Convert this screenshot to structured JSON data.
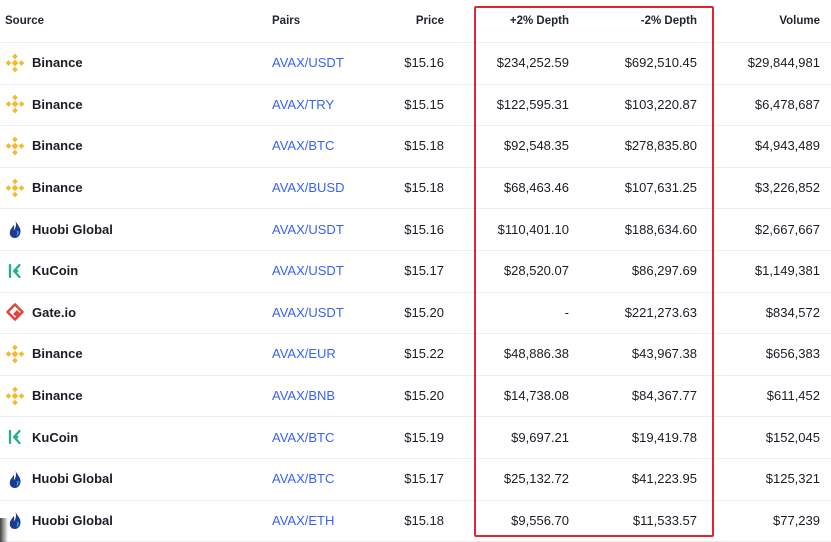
{
  "headers": {
    "source": "Source",
    "pairs": "Pairs",
    "price": "Price",
    "plus_depth": "+2% Depth",
    "minus_depth": "-2% Depth",
    "volume": "Volume"
  },
  "colors": {
    "pair_link": "#3861fb",
    "highlight_border": "#dc2633",
    "binance": "#f3ba2f",
    "huobi": "#1a3b8f",
    "kucoin": "#23af91",
    "gate": "#e0463c"
  },
  "rows": [
    {
      "exchange": "Binance",
      "icon": "binance-icon",
      "pair": "AVAX/USDT",
      "price": "$15.16",
      "plus_depth": "$234,252.59",
      "minus_depth": "$692,510.45",
      "volume": "$29,844,981"
    },
    {
      "exchange": "Binance",
      "icon": "binance-icon",
      "pair": "AVAX/TRY",
      "price": "$15.15",
      "plus_depth": "$122,595.31",
      "minus_depth": "$103,220.87",
      "volume": "$6,478,687"
    },
    {
      "exchange": "Binance",
      "icon": "binance-icon",
      "pair": "AVAX/BTC",
      "price": "$15.18",
      "plus_depth": "$92,548.35",
      "minus_depth": "$278,835.80",
      "volume": "$4,943,489"
    },
    {
      "exchange": "Binance",
      "icon": "binance-icon",
      "pair": "AVAX/BUSD",
      "price": "$15.18",
      "plus_depth": "$68,463.46",
      "minus_depth": "$107,631.25",
      "volume": "$3,226,852"
    },
    {
      "exchange": "Huobi Global",
      "icon": "huobi-icon",
      "pair": "AVAX/USDT",
      "price": "$15.16",
      "plus_depth": "$110,401.10",
      "minus_depth": "$188,634.60",
      "volume": "$2,667,667"
    },
    {
      "exchange": "KuCoin",
      "icon": "kucoin-icon",
      "pair": "AVAX/USDT",
      "price": "$15.17",
      "plus_depth": "$28,520.07",
      "minus_depth": "$86,297.69",
      "volume": "$1,149,381"
    },
    {
      "exchange": "Gate.io",
      "icon": "gate-icon",
      "pair": "AVAX/USDT",
      "price": "$15.20",
      "plus_depth": "-",
      "minus_depth": "$221,273.63",
      "volume": "$834,572"
    },
    {
      "exchange": "Binance",
      "icon": "binance-icon",
      "pair": "AVAX/EUR",
      "price": "$15.22",
      "plus_depth": "$48,886.38",
      "minus_depth": "$43,967.38",
      "volume": "$656,383"
    },
    {
      "exchange": "Binance",
      "icon": "binance-icon",
      "pair": "AVAX/BNB",
      "price": "$15.20",
      "plus_depth": "$14,738.08",
      "minus_depth": "$84,367.77",
      "volume": "$611,452"
    },
    {
      "exchange": "KuCoin",
      "icon": "kucoin-icon",
      "pair": "AVAX/BTC",
      "price": "$15.19",
      "plus_depth": "$9,697.21",
      "minus_depth": "$19,419.78",
      "volume": "$152,045"
    },
    {
      "exchange": "Huobi Global",
      "icon": "huobi-icon",
      "pair": "AVAX/BTC",
      "price": "$15.17",
      "plus_depth": "$25,132.72",
      "minus_depth": "$41,223.95",
      "volume": "$125,321"
    },
    {
      "exchange": "Huobi Global",
      "icon": "huobi-icon",
      "pair": "AVAX/ETH",
      "price": "$15.18",
      "plus_depth": "$9,556.70",
      "minus_depth": "$11,533.57",
      "volume": "$77,239"
    }
  ]
}
